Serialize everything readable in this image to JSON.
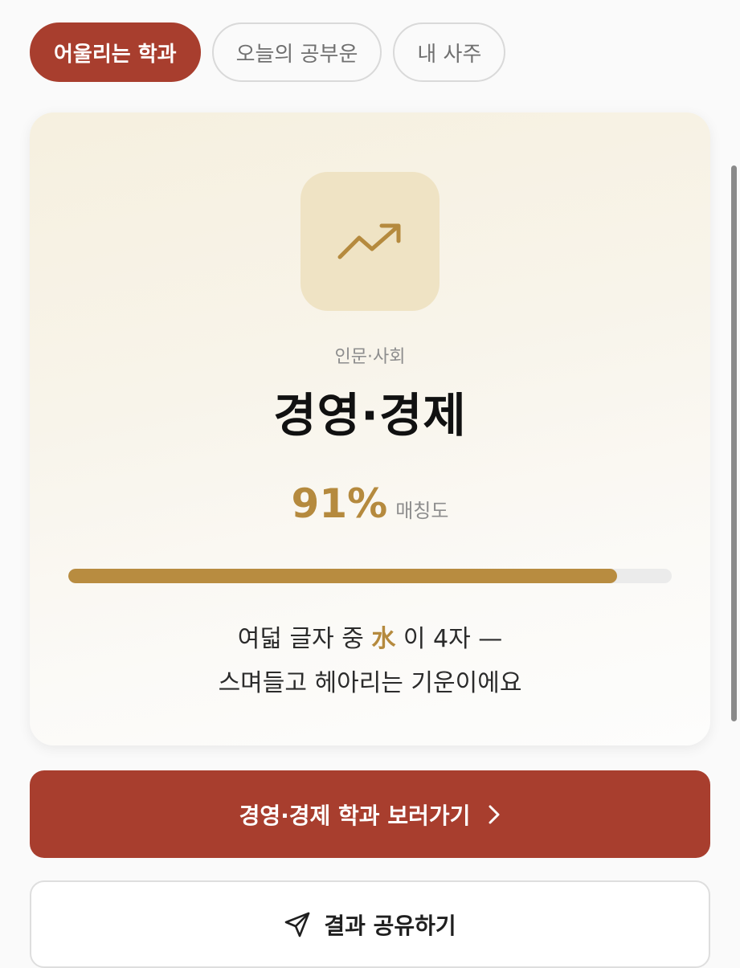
{
  "tabs": [
    {
      "label": "어울리는 학과",
      "active": true
    },
    {
      "label": "오늘의 공부운",
      "active": false
    },
    {
      "label": "내 사주",
      "active": false
    }
  ],
  "result": {
    "icon": "trending-up-icon",
    "category": "인문·사회",
    "major": "경영·경제",
    "match_percent": "91%",
    "match_value": 91,
    "match_unit": "매칭도",
    "description_line1_prefix": "여덟 글자 중",
    "description_element": "水",
    "description_line1_suffix": "이 4자 —",
    "description_line2": "스며들고 헤아리는 기운이에요"
  },
  "actions": {
    "primary_label": "경영·경제 학과 보러가기",
    "primary_icon": "chevron-right-icon",
    "secondary_label": "결과 공유하기",
    "secondary_icon": "send-icon"
  },
  "colors": {
    "accent_red": "#a83e2e",
    "gold": "#b58a3e",
    "icon_bg": "#efe3c4"
  }
}
